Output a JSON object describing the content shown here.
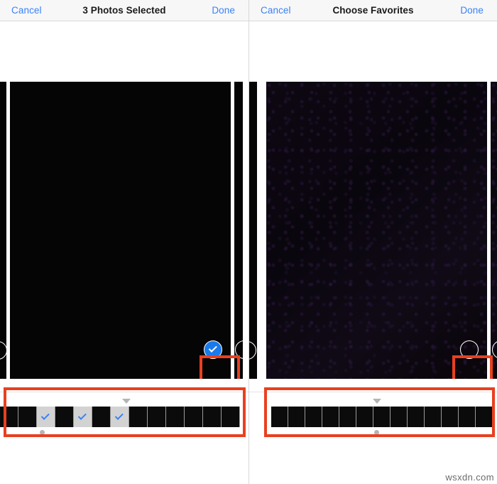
{
  "watermark": "wsxdn.com",
  "colors": {
    "accent_blue": "#3a82f7",
    "selected_circle_blue": "#1a7aeb",
    "annotation_red": "#e8401f",
    "navbar_bg": "#f7f7f7",
    "photo_black": "#050505",
    "filmstrip_checked_bg": "#d2d2d2",
    "marker_gray": "#b4b4b4"
  },
  "panels": [
    {
      "id": "photos-selected",
      "navbar": {
        "cancel_label": "Cancel",
        "title": "3 Photos Selected",
        "done_label": "Done"
      },
      "stage": {
        "selection_state": "selected",
        "selection_icon": "checkmark-circle-filled-icon",
        "edge_left_photo": true,
        "edge_right_photo": true,
        "edge_left_circle": "circle-outline-partial-icon",
        "edge_right_circle": "circle-outline-partial-icon"
      },
      "filmstrip": {
        "marker_icon": "triangle-down-icon",
        "dot_icon": "position-dot-icon",
        "cells": [
          {
            "type": "dark",
            "checked": false
          },
          {
            "type": "dark",
            "checked": false
          },
          {
            "type": "checked",
            "checked": true
          },
          {
            "type": "dark",
            "checked": false
          },
          {
            "type": "checked",
            "checked": true
          },
          {
            "type": "dark",
            "checked": false
          },
          {
            "type": "checked",
            "checked": true
          },
          {
            "type": "dark",
            "checked": false
          },
          {
            "type": "dark",
            "checked": false
          },
          {
            "type": "dark",
            "checked": false
          },
          {
            "type": "dark",
            "checked": false
          },
          {
            "type": "dark",
            "checked": false
          },
          {
            "type": "dark",
            "checked": false
          }
        ]
      }
    },
    {
      "id": "choose-favorites",
      "navbar": {
        "cancel_label": "Cancel",
        "title": "Choose Favorites",
        "done_label": "Done"
      },
      "stage": {
        "selection_state": "unselected",
        "selection_icon": "circle-outline-icon",
        "edge_left_photo": true,
        "edge_right_photo": true,
        "edge_left_circle": "circle-outline-partial-icon",
        "edge_right_circle": "circle-outline-partial-icon"
      },
      "filmstrip": {
        "marker_icon": "triangle-down-icon",
        "dot_icon": "position-dot-icon",
        "cells": [
          {
            "type": "dark",
            "checked": false
          },
          {
            "type": "dark",
            "checked": false
          },
          {
            "type": "dark",
            "checked": false
          },
          {
            "type": "dark",
            "checked": false
          },
          {
            "type": "dark",
            "checked": false
          },
          {
            "type": "dark",
            "checked": false
          },
          {
            "type": "dark",
            "checked": false
          },
          {
            "type": "dark",
            "checked": false
          },
          {
            "type": "dark",
            "checked": false
          },
          {
            "type": "dark",
            "checked": false
          },
          {
            "type": "dark",
            "checked": false
          },
          {
            "type": "dark",
            "checked": false
          },
          {
            "type": "dark",
            "checked": false
          }
        ]
      }
    }
  ]
}
